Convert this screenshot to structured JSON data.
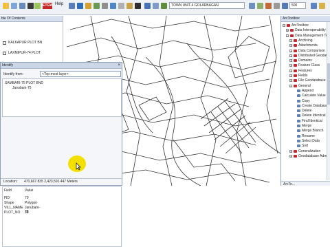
{
  "toolbar": {
    "help_label": "Help",
    "layer_dropdown": "TOWN UNIT-4 GOLARBAGAN",
    "scale": "500",
    "logo_text": "ETGW"
  },
  "toc": {
    "title": "ble Of Contents",
    "layers": [
      {
        "label": "KALKAPUR PLOT BN",
        "checked": true
      },
      {
        "label": "LAXMIPUR-74 PLOT",
        "checked": true
      }
    ]
  },
  "identify": {
    "title": "Identify",
    "from_label": "Identify from:",
    "from_value": "<Top-most layer>",
    "tree": [
      {
        "label": "SAMBARI-75 PLOT BND"
      },
      {
        "label": "Janubani-75"
      }
    ],
    "location_label": "Location:",
    "location_value": "470,667.835  2,423,591.447 Meters",
    "columns": {
      "field": "Field",
      "value": "Value"
    },
    "rows": [
      {
        "field": "FID",
        "value": "70"
      },
      {
        "field": "Shape",
        "value": "Polygon"
      },
      {
        "field": "VILL_NAME",
        "value": "Janubani-75"
      },
      {
        "field": "PLOT_NO",
        "value": "38"
      }
    ]
  },
  "toolbox": {
    "title": "ArcToolbox",
    "items": [
      {
        "label": "ArcToolbox",
        "level": 0,
        "kind": "root"
      },
      {
        "label": "Data Interoperability Tools",
        "level": 1,
        "kind": "box"
      },
      {
        "label": "Data Management Tools",
        "level": 1,
        "kind": "box"
      },
      {
        "label": "Archiving",
        "level": 2,
        "kind": "box"
      },
      {
        "label": "Attachments",
        "level": 2,
        "kind": "box"
      },
      {
        "label": "Data Comparison",
        "level": 2,
        "kind": "box"
      },
      {
        "label": "Distributed Geodatabase",
        "level": 2,
        "kind": "box"
      },
      {
        "label": "Domains",
        "level": 2,
        "kind": "box"
      },
      {
        "label": "Feature Class",
        "level": 2,
        "kind": "box"
      },
      {
        "label": "Features",
        "level": 2,
        "kind": "box"
      },
      {
        "label": "Fields",
        "level": 2,
        "kind": "box"
      },
      {
        "label": "File Geodatabase",
        "level": 2,
        "kind": "box"
      },
      {
        "label": "General",
        "level": 2,
        "kind": "box"
      },
      {
        "label": "Append",
        "level": 3,
        "kind": "tool"
      },
      {
        "label": "Calculate Value",
        "level": 3,
        "kind": "tool"
      },
      {
        "label": "Copy",
        "level": 3,
        "kind": "tool"
      },
      {
        "label": "Create Database View",
        "level": 3,
        "kind": "tool"
      },
      {
        "label": "Delete",
        "level": 3,
        "kind": "tool"
      },
      {
        "label": "Delete Identical",
        "level": 3,
        "kind": "tool"
      },
      {
        "label": "Find Identical",
        "level": 3,
        "kind": "tool"
      },
      {
        "label": "Merge",
        "level": 3,
        "kind": "tool"
      },
      {
        "label": "Merge Branch",
        "level": 3,
        "kind": "tool"
      },
      {
        "label": "Rename",
        "level": 3,
        "kind": "tool"
      },
      {
        "label": "Select Data",
        "level": 3,
        "kind": "tool"
      },
      {
        "label": "Sort",
        "level": 3,
        "kind": "tool"
      },
      {
        "label": "Generalization",
        "level": 2,
        "kind": "box"
      },
      {
        "label": "Geodatabase Administration",
        "level": 2,
        "kind": "box"
      }
    ],
    "footer_tab": "ArcTo..."
  }
}
